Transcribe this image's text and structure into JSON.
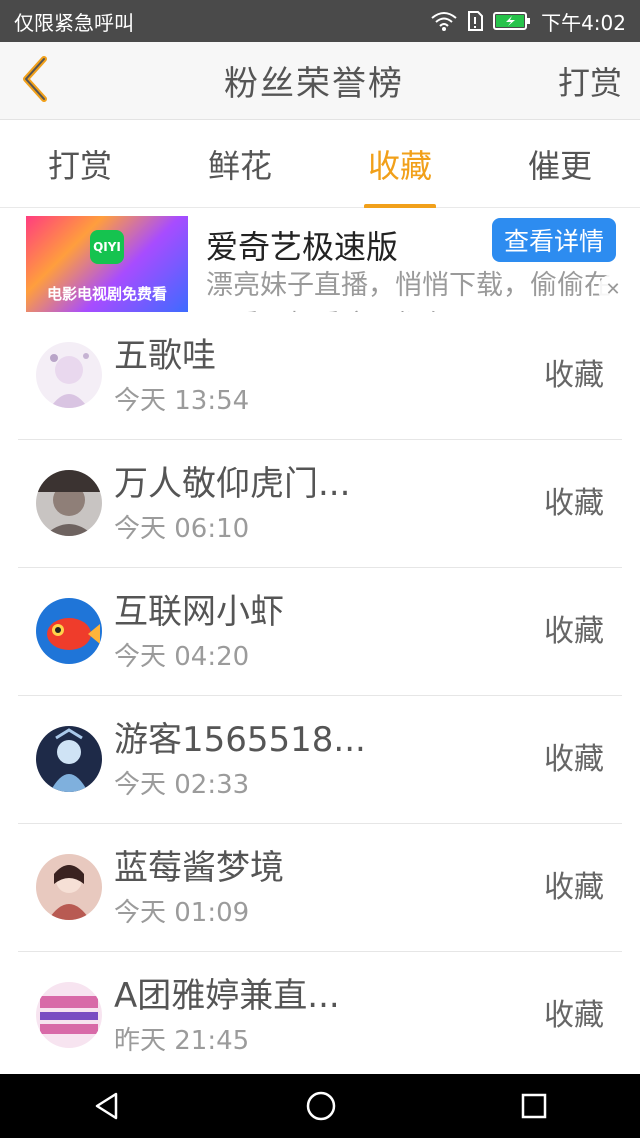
{
  "status": {
    "carrier": "仅限紧急呼叫",
    "time": "下午4:02",
    "icons": [
      "wifi-icon",
      "sim-icon",
      "battery-icon"
    ]
  },
  "navbar": {
    "back_icon": "chevron-left-icon",
    "title": "粉丝荣誉榜",
    "action": "打赏"
  },
  "tabs": [
    {
      "label": "打赏",
      "active": false
    },
    {
      "label": "鲜花",
      "active": false
    },
    {
      "label": "收藏",
      "active": true
    },
    {
      "label": "催更",
      "active": false
    }
  ],
  "ad": {
    "thumb_text": "电影电视剧免费看",
    "logo_text": "QIYI",
    "title": "爱奇艺极速版",
    "button": "查看详情",
    "desc": "漂亮妹子直播，悄悄下载，偷偷在里看，想看这里都有",
    "close_icon": "close-icon"
  },
  "list": [
    {
      "name": "五歌哇",
      "time": "今天 13:54",
      "action": "收藏",
      "avatar_color": "#e9d8ee"
    },
    {
      "name": "万人敬仰虎门...",
      "time": "今天 06:10",
      "action": "收藏",
      "avatar_color": "#8f7f78"
    },
    {
      "name": "互联网小虾",
      "time": "今天 04:20",
      "action": "收藏",
      "avatar_color": "#1f75d8"
    },
    {
      "name": "游客1565518...",
      "time": "今天 02:33",
      "action": "收藏",
      "avatar_color": "#1e2a48"
    },
    {
      "name": "蓝莓酱梦境",
      "time": "今天 01:09",
      "action": "收藏",
      "avatar_color": "#b85a52"
    },
    {
      "name": "A团雅婷兼直...",
      "time": "昨天 21:45",
      "action": "收藏",
      "avatar_color": "#d86aa8"
    }
  ],
  "colors": {
    "accent": "#f1a01a",
    "statusbar": "#4a4a4a",
    "ad_button": "#2d8cf0"
  },
  "system_nav": [
    "back-triangle-icon",
    "home-circle-icon",
    "recent-square-icon"
  ]
}
